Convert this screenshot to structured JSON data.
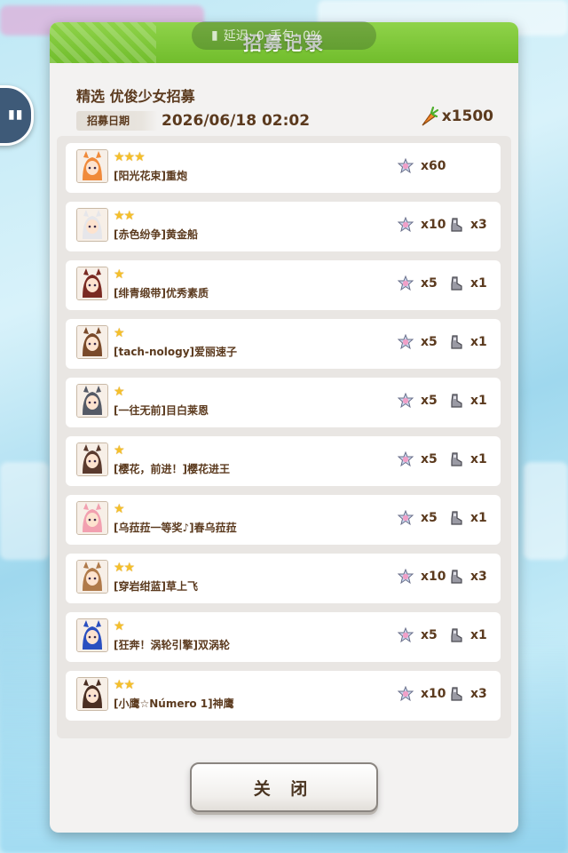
{
  "status_overlay": {
    "network_text": "延迟: 0",
    "packet_text": "丢包: 0%"
  },
  "dialog": {
    "title": "招募记录",
    "banner_name": "精选  优俊少女招募",
    "date_label": "招募日期",
    "date_value": "2026/06/18  02:02",
    "carrot_count": "x1500",
    "close_label": "关 闭"
  },
  "records": [
    {
      "stars": "★★★",
      "name": "[阳光花束]重炮",
      "reward1": "x60",
      "reward2": ""
    },
    {
      "stars": "★★",
      "name": "[赤色纷争]黄金船",
      "reward1": "x10",
      "reward2": "x3"
    },
    {
      "stars": "★",
      "name": "[绯青缎带]优秀素质",
      "reward1": "x5",
      "reward2": "x1"
    },
    {
      "stars": "★",
      "name": "[tach-nology]爱丽速子",
      "reward1": "x5",
      "reward2": "x1"
    },
    {
      "stars": "★",
      "name": "[一往无前]目白莱恩",
      "reward1": "x5",
      "reward2": "x1"
    },
    {
      "stars": "★",
      "name": "[樱花，前进！]樱花进王",
      "reward1": "x5",
      "reward2": "x1"
    },
    {
      "stars": "★",
      "name": "[乌菈菈一等奖♪]春乌菈菈",
      "reward1": "x5",
      "reward2": "x1"
    },
    {
      "stars": "★★",
      "name": "[穿岩绀蓝]草上飞",
      "reward1": "x10",
      "reward2": "x3"
    },
    {
      "stars": "★",
      "name": "[狂奔！涡轮引擎]双涡轮",
      "reward1": "x5",
      "reward2": "x1"
    },
    {
      "stars": "★★",
      "name": "[小鹰☆Número  1]神鹰",
      "reward1": "x10",
      "reward2": "x3"
    }
  ],
  "colors": {
    "header_green": "#7cc83a",
    "text_brown": "#5b3a1e",
    "star_gold": "#f5c02a",
    "panel_bg": "#f3f2f1"
  },
  "icons": {
    "avatar": "character-portrait-icon",
    "reward1": "goddess-piece-icon",
    "reward2": "shoe-piece-icon",
    "carrot": "carrot-icon"
  }
}
